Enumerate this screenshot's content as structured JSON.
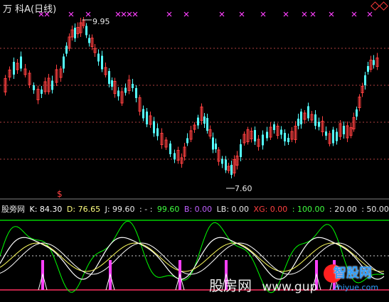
{
  "window_title": "万 科A(日线)",
  "price_labels": {
    "high": "9.95",
    "low": "7.60"
  },
  "indicator_bar": {
    "name": "股旁网",
    "k": "K: 84.30",
    "d": "D: 76.65",
    "j": "J: 99.60",
    "dash": ": - :",
    "v1": "99.60",
    "b": "B: 0.00",
    "lb": "LB: 0.00",
    "xg_label": "XG:",
    "xg_value": "0.00",
    "v2": ": 100.00",
    "v3": ": 20.00",
    "v4": ": 50.00"
  },
  "signal_marker": "$",
  "watermark": {
    "left": "股房网",
    "url": "www.gup",
    "logo_big": "智股网",
    "logo_url": "zhiyue.com"
  },
  "colors": {
    "bg": "#000000",
    "up": "#ff4040",
    "down": "#54ffff",
    "grid": "#b04040",
    "k_line": "#ffffff",
    "d_line": "#ffff60",
    "j_line": "#00ff00",
    "mark": "#ff40ff",
    "ref_top": "#00d000",
    "ref_bottom": "#ff3060"
  },
  "icons": {
    "window": "diamond-icon",
    "signal": "cross-marker-icon"
  }
}
